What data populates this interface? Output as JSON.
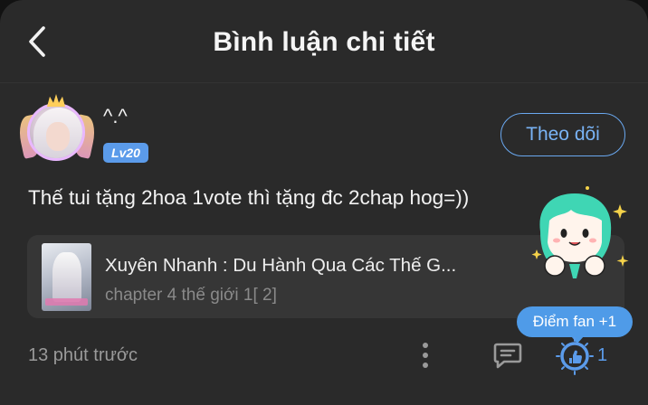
{
  "header": {
    "title": "Bình luận chi tiết"
  },
  "comment": {
    "username": "^.^",
    "level": "Lv20",
    "follow_label": "Theo dõi",
    "text": "Thế tui tặng 2hoa 1vote thì tặng đc 2chap hog=))",
    "timestamp": "13 phút trước",
    "like_count": "1"
  },
  "book": {
    "title": "Xuyên Nhanh : Du Hành Qua Các Thế G...",
    "chapter": "chapter 4 thế giới 1[ 2]"
  },
  "reward": {
    "tooltip": "Điểm fan +1"
  },
  "colors": {
    "background": "#2a2a2a",
    "accent": "#5b9bea",
    "card": "#363636",
    "muted_text": "#9a9a9a"
  },
  "icons": {
    "back": "chevron-left-icon",
    "more": "more-vertical-icon",
    "reply": "comment-icon",
    "like": "thumbs-up-icon",
    "mascot": "mascot-sticker-icon"
  }
}
